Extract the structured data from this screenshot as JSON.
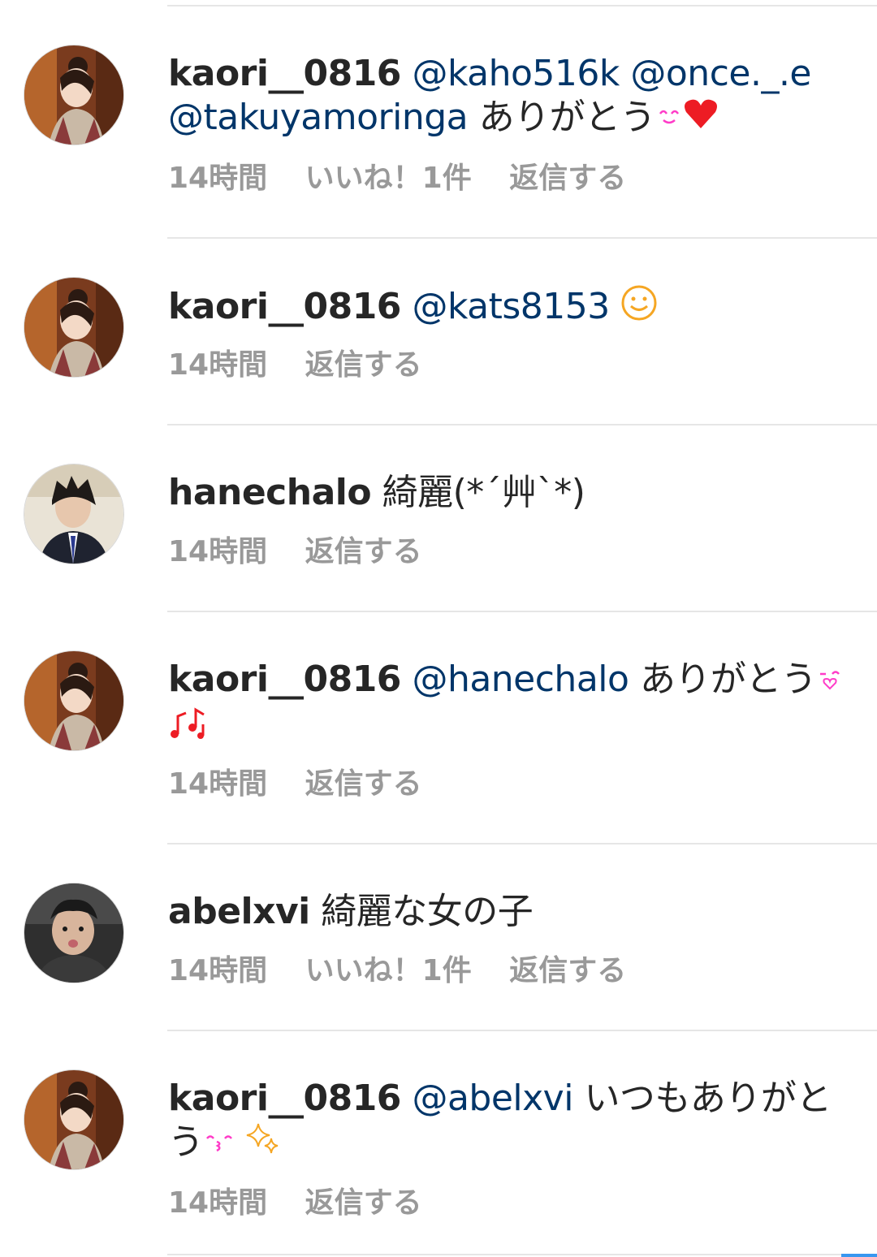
{
  "comments": [
    {
      "username": "kaori__0816",
      "mentions": [
        "@kaho516k",
        "@once._.e",
        "@takuyamoringa"
      ],
      "text": "ありがとう",
      "emoji": [
        "smiling-eyes",
        "heart"
      ],
      "time": "14時間",
      "likes": "いいね！1件",
      "reply": "返信する"
    },
    {
      "username": "kaori__0816",
      "mentions": [
        "@kats8153"
      ],
      "text": "",
      "emoji": [
        "smiley"
      ],
      "time": "14時間",
      "likes": "",
      "reply": "返信する"
    },
    {
      "username": "hanechalo",
      "mentions": [],
      "text": "綺麗(*´艸`*)",
      "emoji": [],
      "time": "14時間",
      "likes": "",
      "reply": "返信する"
    },
    {
      "username": "kaori__0816",
      "mentions": [
        "@hanechalo"
      ],
      "text": "ありがとう",
      "emoji": [
        "winking-heart",
        "music-notes"
      ],
      "time": "14時間",
      "likes": "",
      "reply": "返信する"
    },
    {
      "username": "abelxvi",
      "mentions": [],
      "text": "綺麗な女の子",
      "emoji": [],
      "time": "14時間",
      "likes": "いいね！1件",
      "reply": "返信する"
    },
    {
      "username": "kaori__0816",
      "mentions": [
        "@abelxvi"
      ],
      "text": "いつもありがと",
      "text2": "う",
      "emoji": [
        "kiss-face",
        "sparkles"
      ],
      "time": "14時間",
      "likes": "",
      "reply": "返信する"
    }
  ],
  "colors": {
    "mention": "#003569",
    "meta": "#999999",
    "heart": "#ed1c24",
    "emoji_pink": "#ff3cc8",
    "emoji_orange": "#f5a623",
    "scroll_accent": "#3897f0"
  }
}
